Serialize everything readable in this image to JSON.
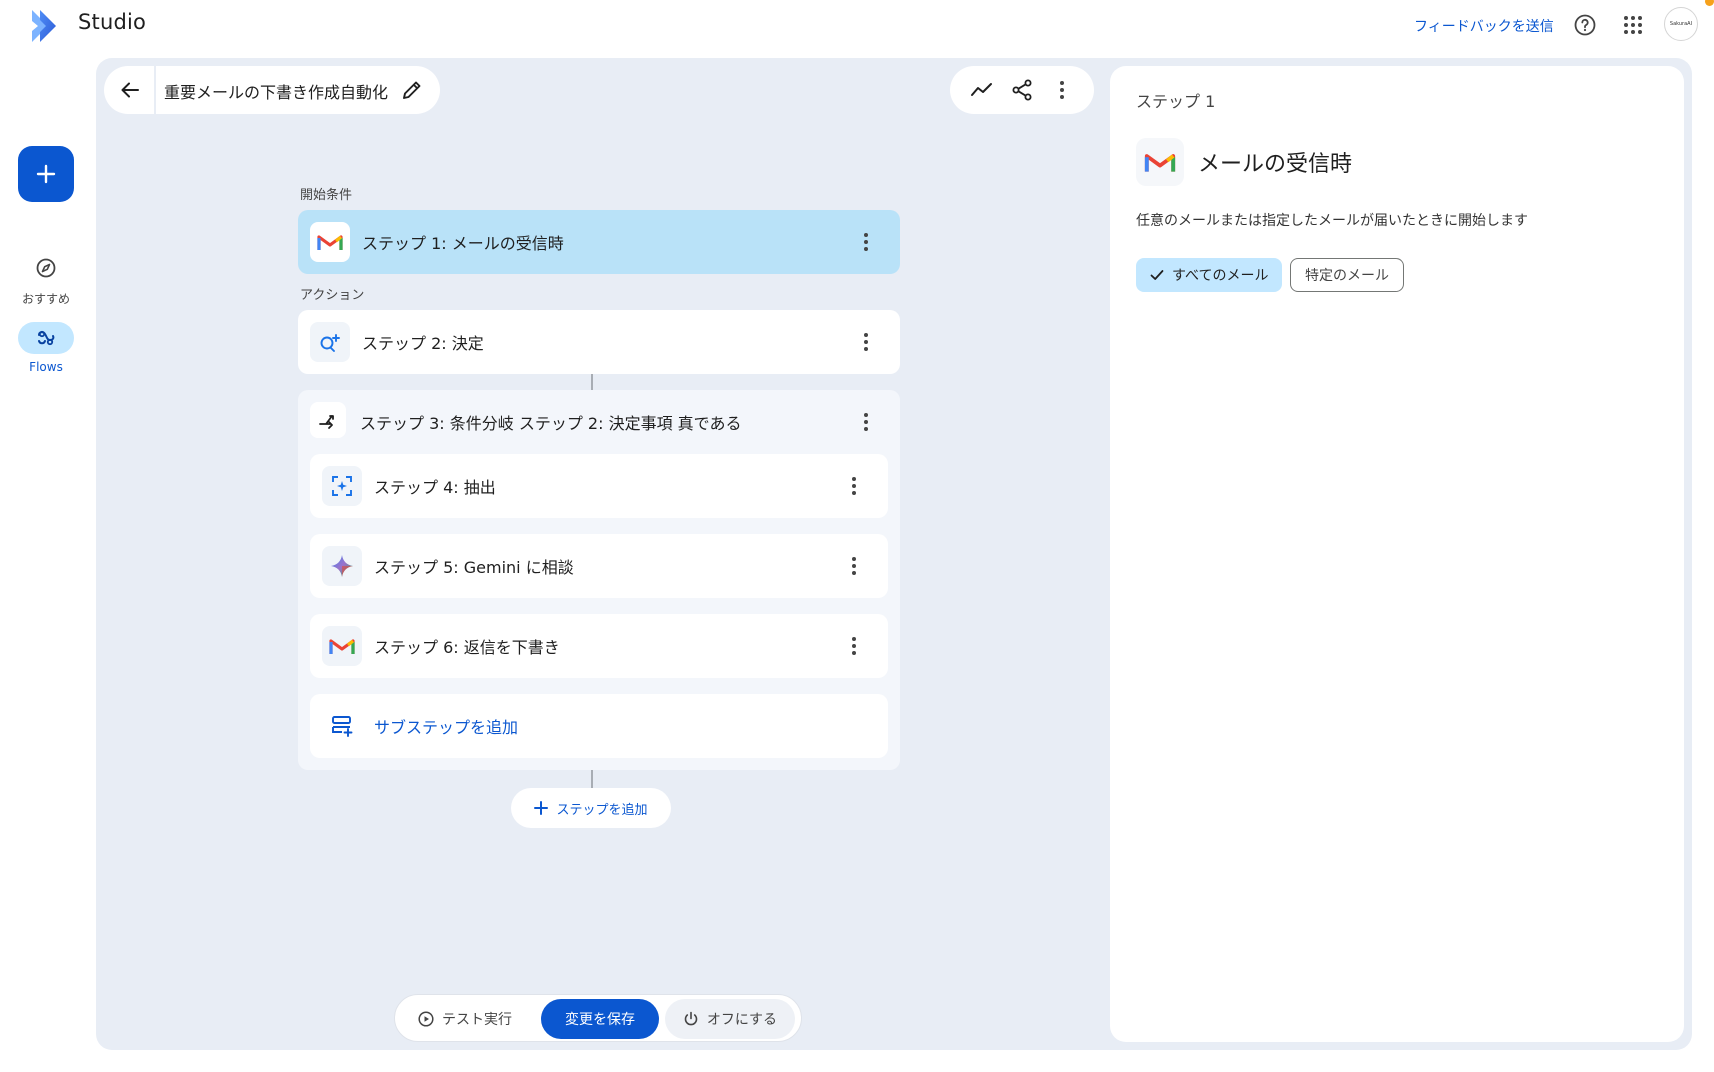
{
  "app": {
    "name": "Studio"
  },
  "header": {
    "feedback_label": "フィードバックを送信",
    "avatar_text": "SakuraAI"
  },
  "rail": {
    "create_label": "+",
    "items": [
      {
        "label": "おすすめ",
        "icon": "compass-icon",
        "active": false
      },
      {
        "label": "Flows",
        "icon": "flows-icon",
        "active": true
      }
    ]
  },
  "flow": {
    "title": "重要メールの下書き作成自動化"
  },
  "sections": {
    "trigger": "開始条件",
    "actions": "アクション"
  },
  "steps": [
    {
      "label": "ステップ 1: メールの受信時",
      "icon": "gmail-icon",
      "selected": true
    },
    {
      "label": "ステップ 2: 決定",
      "icon": "decide-icon"
    },
    {
      "label": "ステップ 3: 条件分岐 ステップ 2: 決定事項 真である",
      "icon": "branch-icon"
    },
    {
      "label": "ステップ 4: 抽出",
      "icon": "extract-icon"
    },
    {
      "label": "ステップ 5: Gemini に相談",
      "icon": "gemini-icon"
    },
    {
      "label": "ステップ 6: 返信を下書き",
      "icon": "gmail-icon"
    }
  ],
  "add_substep_label": "サブステップを追加",
  "add_step_label": "ステップを追加",
  "bottom_bar": {
    "test_label": "テスト実行",
    "save_label": "変更を保存",
    "off_label": "オフにする"
  },
  "panel": {
    "step_label": "ステップ 1",
    "title": "メールの受信時",
    "description": "任意のメールまたは指定したメールが届いたときに開始します",
    "chips": [
      {
        "label": "すべてのメール",
        "selected": true
      },
      {
        "label": "特定のメール",
        "selected": false
      }
    ]
  },
  "colors": {
    "accent": "#0b57d0",
    "selected_card": "#b9e2f8",
    "canvas": "#e8edf5",
    "chip_selected": "#c2e7ff"
  }
}
